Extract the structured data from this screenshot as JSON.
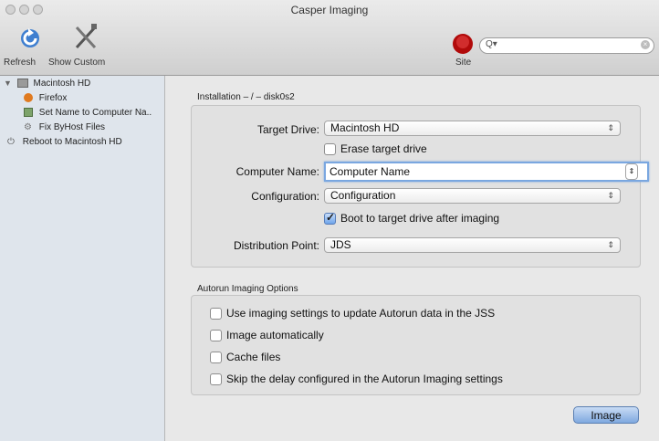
{
  "window": {
    "title": "Casper Imaging"
  },
  "toolbar": {
    "refresh_label": "Refresh",
    "show_custom_label": "Show Custom",
    "site_label": "Site",
    "search_placeholder": ""
  },
  "sidebar": {
    "disk": "Macintosh HD",
    "items": [
      {
        "label": "Firefox",
        "icon": "firefox-icon"
      },
      {
        "label": "Set Name to Computer Na..",
        "icon": "script-icon"
      },
      {
        "label": "Fix ByHost Files",
        "icon": "gear-icon"
      },
      {
        "label": "Reboot to Macintosh HD",
        "icon": "power-icon"
      }
    ]
  },
  "installation": {
    "header": "Installation – / – disk0s2",
    "target_drive_label": "Target Drive:",
    "target_drive_value": "Macintosh HD",
    "erase_label": "Erase target drive",
    "erase_checked": false,
    "computer_name_label": "Computer Name:",
    "computer_name_value": "Computer Name",
    "configuration_label": "Configuration:",
    "configuration_value": "Configuration",
    "boot_label": "Boot to target drive after imaging",
    "boot_checked": true,
    "distribution_label": "Distribution Point:",
    "distribution_value": "JDS"
  },
  "autorun": {
    "header": "Autorun Imaging Options",
    "options": [
      {
        "label": "Use imaging settings to update Autorun data in the JSS",
        "checked": false
      },
      {
        "label": "Image automatically",
        "checked": false
      },
      {
        "label": "Cache files",
        "checked": false
      },
      {
        "label": "Skip the delay configured in the Autorun Imaging settings",
        "checked": false
      }
    ]
  },
  "actions": {
    "image_label": "Image"
  }
}
